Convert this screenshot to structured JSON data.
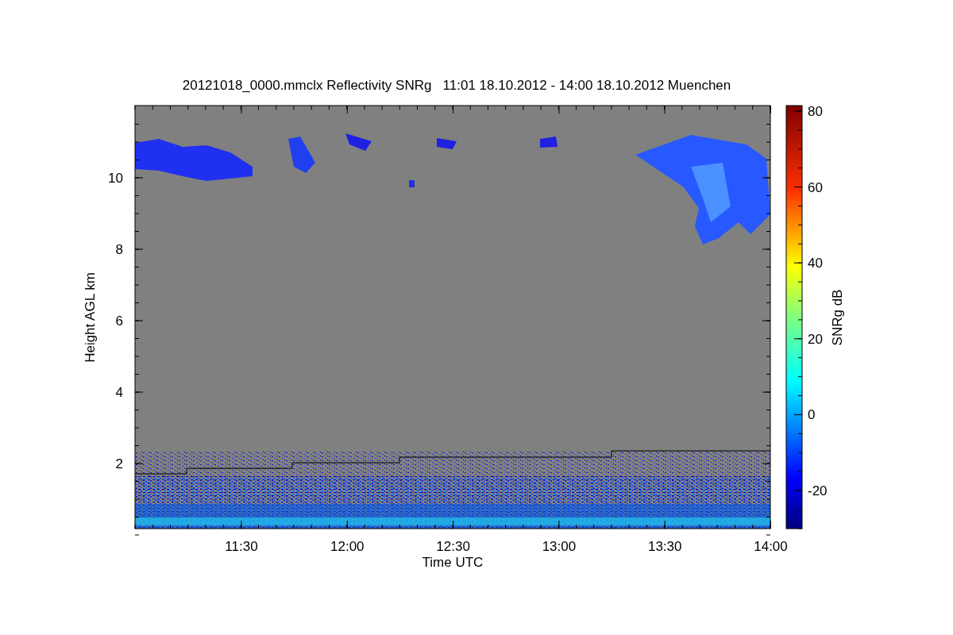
{
  "title": "20121018_0000.mmclx Reflectivity SNRg   11:01 18.10.2012 - 14:00 18.10.2012 Muenchen",
  "plot": {
    "xlabel": "Time UTC",
    "ylabel": "Height AGL km",
    "xticks": [
      "11:30",
      "12:00",
      "12:30",
      "13:00",
      "13:30",
      "14:00"
    ],
    "yticks": [
      "10",
      "8",
      "6",
      "4",
      "2"
    ]
  },
  "colorbar": {
    "label": "SNRg dB",
    "ticks": [
      "80",
      "60",
      "40",
      "20",
      "0",
      "-20"
    ]
  }
}
